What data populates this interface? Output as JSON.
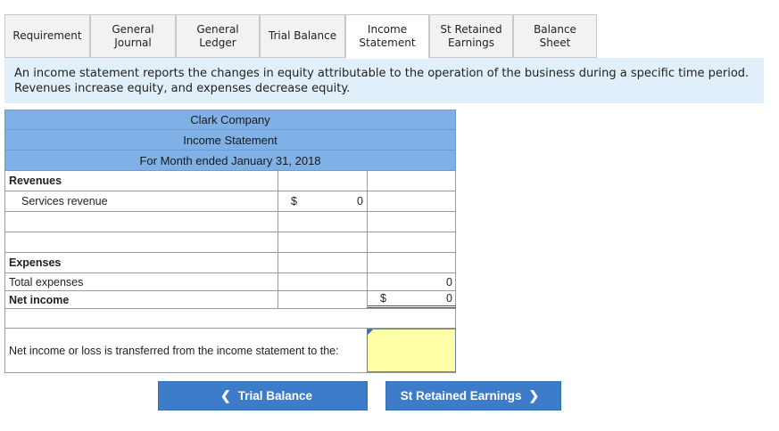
{
  "tabs": [
    {
      "label": "Requirement",
      "active": false
    },
    {
      "label": "General Journal",
      "active": false
    },
    {
      "label": "General Ledger",
      "active": false
    },
    {
      "label": "Trial Balance",
      "active": false
    },
    {
      "label": "Income Statement",
      "active": true
    },
    {
      "label": "St Retained Earnings",
      "active": false
    },
    {
      "label": "Balance Sheet",
      "active": false
    }
  ],
  "banner": {
    "text": "An income statement reports the changes in equity attributable to the operation of the business during a specific time period. Revenues increase equity, and expenses decrease equity."
  },
  "statement": {
    "company": "Clark Company",
    "title": "Income Statement",
    "period": "For Month ended January 31, 2018",
    "revenues_label": "Revenues",
    "services_revenue_label": "Services revenue",
    "services_revenue_currency": "$",
    "services_revenue_value": "0",
    "expenses_label": "Expenses",
    "total_expenses_label": "Total expenses",
    "total_expenses_value": "0",
    "net_income_label": "Net income",
    "net_income_currency": "$",
    "net_income_value": "0",
    "transfer_prompt": "Net income or loss is transferred from the income statement to the:",
    "transfer_answer": ""
  },
  "nav": {
    "prev_label": "Trial Balance",
    "prev_icon": "chevron-left-icon",
    "next_label": "St Retained Earnings",
    "next_icon": "chevron-right-icon"
  },
  "colors": {
    "header_blue": "#7fb0e6",
    "banner_bg": "#e1effa",
    "button_blue": "#3d7cc9",
    "answer_yellow": "#ffffa8"
  }
}
